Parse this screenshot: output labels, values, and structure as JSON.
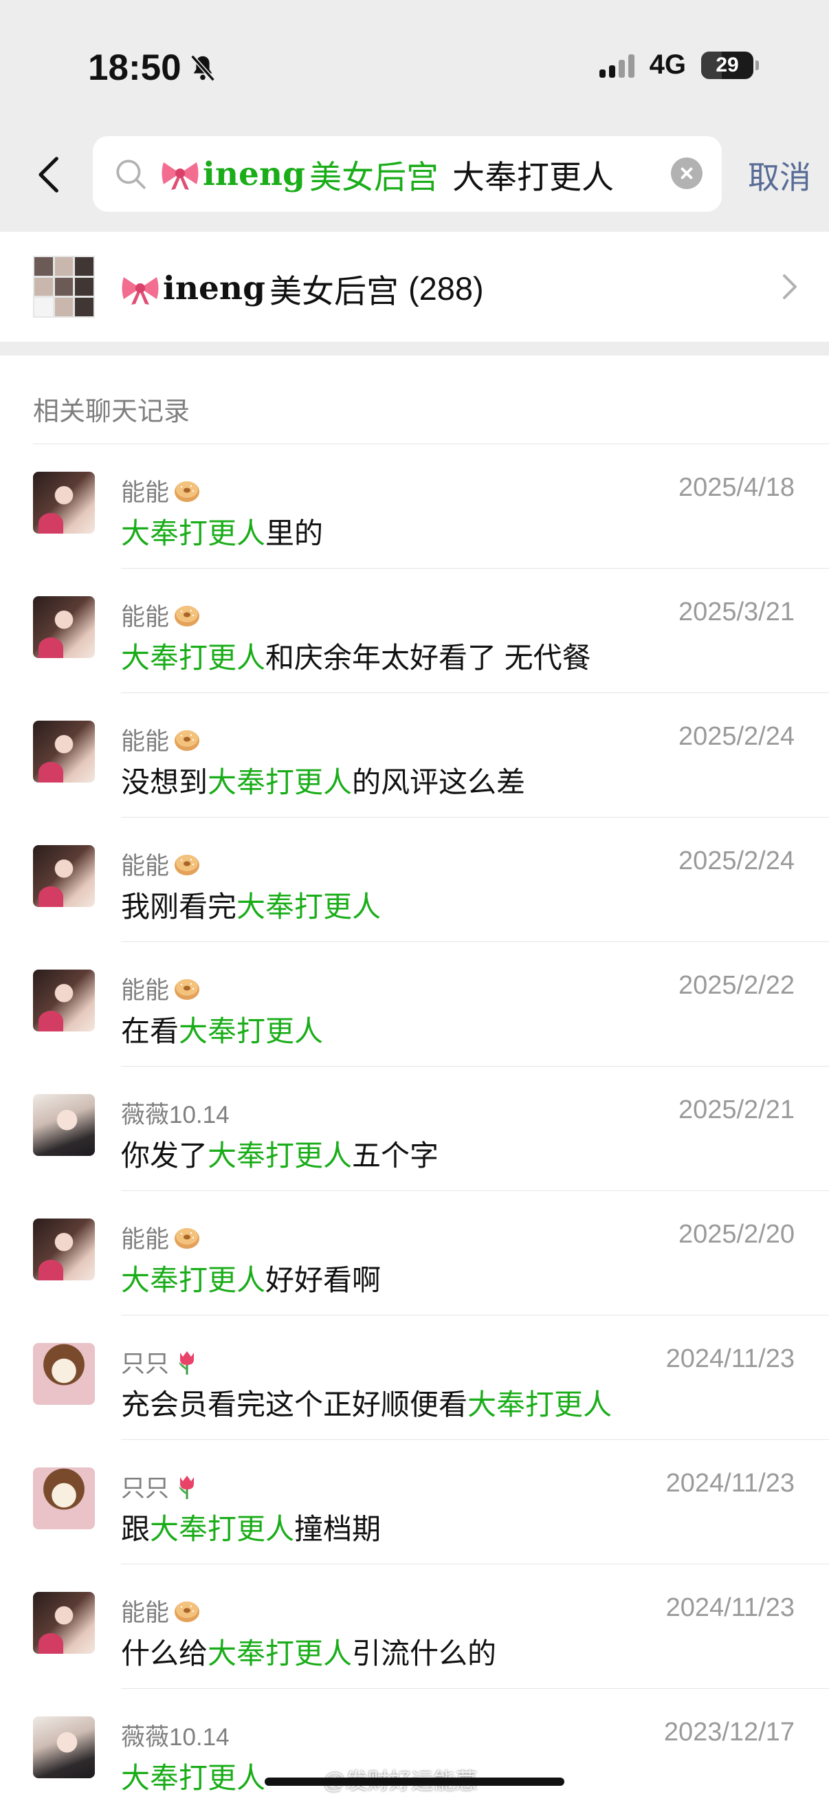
{
  "status_bar": {
    "time": "18:50",
    "network": "4G",
    "battery": "29"
  },
  "search": {
    "chip_name": "ineng",
    "chip_group": "美女后宫",
    "query": "大奉打更人",
    "cancel_label": "取消"
  },
  "group": {
    "name": "ineng",
    "name_cn": "美女后宫",
    "count": "(288)"
  },
  "section_title": "相关聊天记录",
  "messages": [
    {
      "sender": "能能",
      "sender_emoji": "bagel-emoji",
      "date": "2025/4/18",
      "pre": "",
      "hl": "大奉打更人",
      "post": "里的",
      "avatar": "girl-a"
    },
    {
      "sender": "能能",
      "sender_emoji": "bagel-emoji",
      "date": "2025/3/21",
      "pre": "",
      "hl": "大奉打更人",
      "post": "和庆余年太好看了 无代餐",
      "avatar": "girl-a"
    },
    {
      "sender": "能能",
      "sender_emoji": "bagel-emoji",
      "date": "2025/2/24",
      "pre": "没想到",
      "hl": "大奉打更人",
      "post": "的风评这么差",
      "avatar": "girl-a"
    },
    {
      "sender": "能能",
      "sender_emoji": "bagel-emoji",
      "date": "2025/2/24",
      "pre": "我刚看完",
      "hl": "大奉打更人",
      "post": "",
      "avatar": "girl-a"
    },
    {
      "sender": "能能",
      "sender_emoji": "bagel-emoji",
      "date": "2025/2/22",
      "pre": "在看",
      "hl": "大奉打更人",
      "post": "",
      "avatar": "girl-a"
    },
    {
      "sender": "薇薇10.14",
      "sender_emoji": "",
      "date": "2025/2/21",
      "pre": "你发了",
      "hl": "大奉打更人",
      "post": "五个字",
      "avatar": "girl-b"
    },
    {
      "sender": "能能",
      "sender_emoji": "bagel-emoji",
      "date": "2025/2/20",
      "pre": "",
      "hl": "大奉打更人",
      "post": "好好看啊",
      "avatar": "girl-a"
    },
    {
      "sender": "只只",
      "sender_emoji": "tulip-emoji",
      "date": "2024/11/23",
      "pre": "充会员看完这个正好顺便看",
      "hl": "大奉打更人",
      "post": "",
      "avatar": "cartoon"
    },
    {
      "sender": "只只",
      "sender_emoji": "tulip-emoji",
      "date": "2024/11/23",
      "pre": "跟",
      "hl": "大奉打更人",
      "post": "撞档期",
      "avatar": "cartoon"
    },
    {
      "sender": "能能",
      "sender_emoji": "bagel-emoji",
      "date": "2024/11/23",
      "pre": "什么给",
      "hl": "大奉打更人",
      "post": "引流什么的",
      "avatar": "girl-a"
    },
    {
      "sender": "薇薇10.14",
      "sender_emoji": "",
      "date": "2023/12/17",
      "pre": "",
      "hl": "大奉打更人",
      "post": "",
      "avatar": "girl-b"
    }
  ],
  "watermark": "@发财好运能蒽"
}
